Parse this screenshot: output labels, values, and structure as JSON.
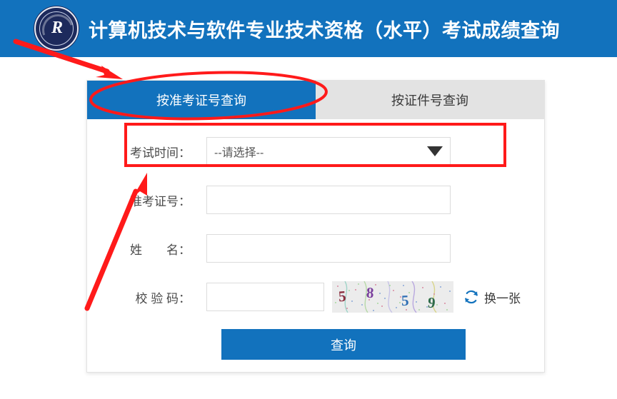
{
  "header": {
    "title": "计算机技术与软件专业技术资格（水平）考试成绩查询",
    "logo_mark": "R",
    "logo_name": "certification-seal-logo",
    "background_color": "#1272bd",
    "title_color": "#ffffff"
  },
  "tabs": [
    {
      "label": "按准考证号查询",
      "active": true,
      "name": "tab-by-admission-ticket"
    },
    {
      "label": "按证件号查询",
      "active": false,
      "name": "tab-by-id-number"
    }
  ],
  "form": {
    "exam_time": {
      "label": "考试时间：",
      "selected": "--请选择--",
      "caret_icon": "chevron-down-icon"
    },
    "admission_number": {
      "label": "准考证号：",
      "value": "",
      "placeholder": ""
    },
    "name": {
      "label": "姓　　名：",
      "value": "",
      "placeholder": ""
    },
    "captcha": {
      "label": "校 验 码：",
      "value": "",
      "placeholder": "",
      "image_text": "5859",
      "characters": [
        {
          "char": "5",
          "color": "#8a2e3e"
        },
        {
          "char": "8",
          "color": "#7a3f9d"
        },
        {
          "char": "5",
          "color": "#2f6fb5"
        },
        {
          "char": "9",
          "color": "#2f6b4a"
        }
      ],
      "refresh_label": "换一张",
      "refresh_icon": "refresh-icon",
      "refresh_color": "#1272bd"
    },
    "submit": {
      "label": "查询",
      "color": "#1272bd"
    }
  },
  "annotations": {
    "color": "#ff1a1a",
    "ellipse_target": "按准考证号查询",
    "rectangle_target": "考试时间：",
    "arrow_count": 2
  }
}
